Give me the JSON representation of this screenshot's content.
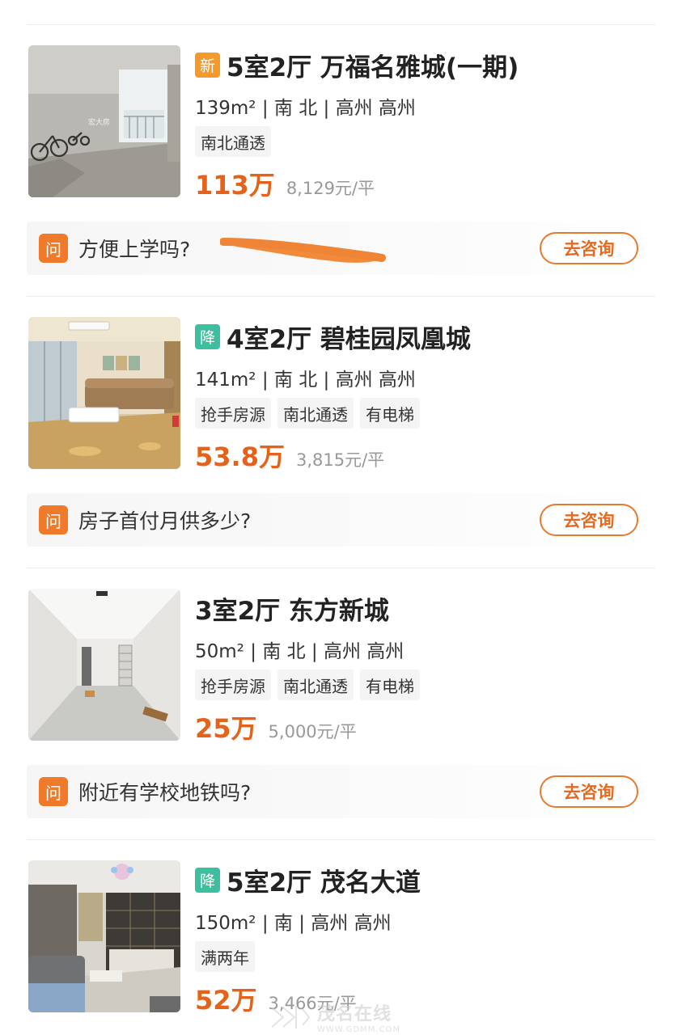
{
  "listings": [
    {
      "badge": "新",
      "badge_type": "new",
      "title": "5室2厅 万福名雅城(一期)",
      "meta": "139m² | 南 北 | 高州 高州",
      "tags": [
        "南北通透"
      ],
      "price": "113万",
      "unit_price": "8,129元/平",
      "photo_watermark": "宏大房",
      "question": "方便上学吗?",
      "consult_label": "去咨询"
    },
    {
      "badge": "降",
      "badge_type": "drop",
      "title": "4室2厅 碧桂园凤凰城",
      "meta": "141m² | 南 北 | 高州 高州",
      "tags": [
        "抢手房源",
        "南北通透",
        "有电梯"
      ],
      "price": "53.8万",
      "unit_price": "3,815元/平",
      "question": "房子首付月供多少?",
      "consult_label": "去咨询"
    },
    {
      "badge": "",
      "badge_type": "none",
      "title": "3室2厅 东方新城",
      "meta": "50m² | 南 北 | 高州 高州",
      "tags": [
        "抢手房源",
        "南北通透",
        "有电梯"
      ],
      "price": "25万",
      "unit_price": "5,000元/平",
      "question": "附近有学校地铁吗?",
      "consult_label": "去咨询"
    },
    {
      "badge": "降",
      "badge_type": "drop",
      "title": "5室2厅 茂名大道",
      "meta": "150m² | 南 | 高州 高州",
      "tags": [
        "满两年"
      ],
      "price": "52万",
      "unit_price": "3,466元/平"
    }
  ],
  "qa_icon_label": "问",
  "watermark": {
    "name": "茂名在线",
    "url": "WWW.GDMM.COM"
  },
  "colors": {
    "price": "#e5621b",
    "badge_new": "#f39a2b",
    "badge_drop": "#3dbf9f",
    "qa_icon": "#f07a2c",
    "consult_border": "#e87a2e"
  }
}
